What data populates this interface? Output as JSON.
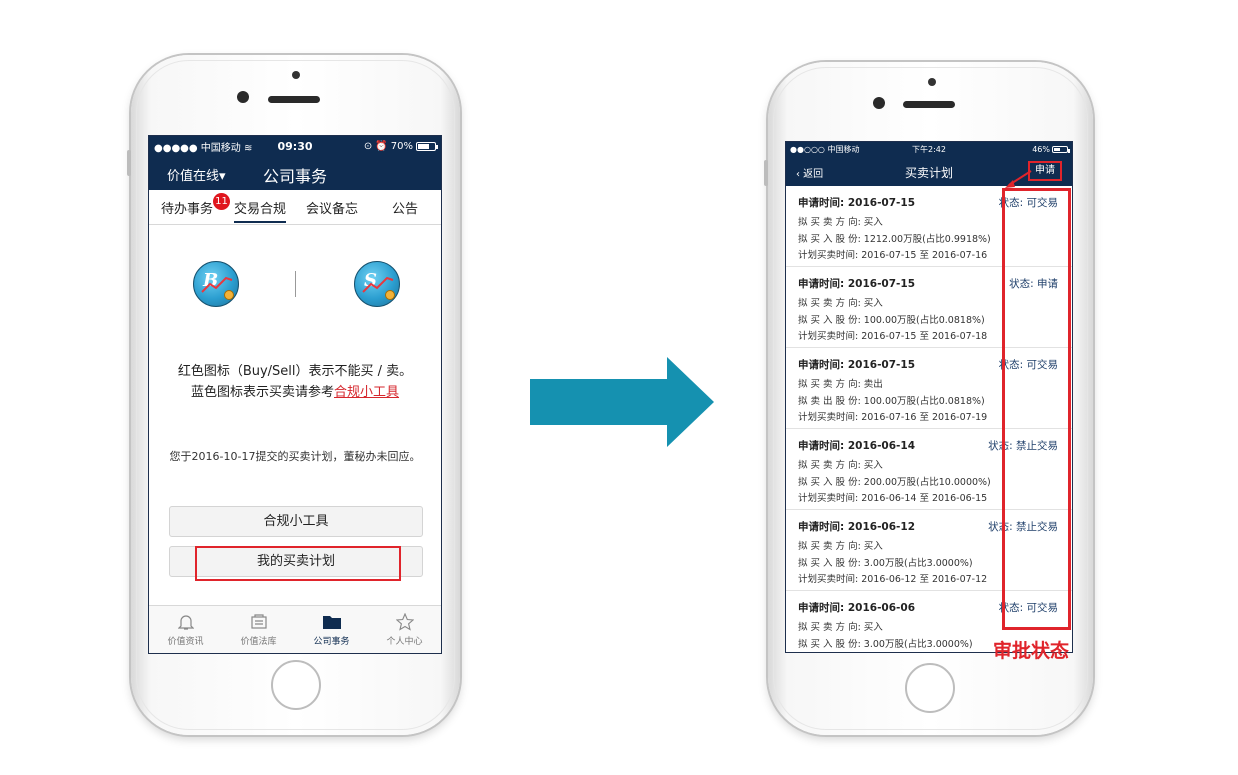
{
  "left": {
    "status_bar": {
      "carrier": "●●●●● 中国移动 ",
      "time": "09:30",
      "battery": "70%"
    },
    "nav": {
      "left_label": "价值在线▾",
      "title": "公司事务"
    },
    "tabs": [
      {
        "label": "待办事务",
        "badge": "11"
      },
      {
        "label": "交易合规"
      },
      {
        "label": "会议备忘"
      },
      {
        "label": "公告"
      }
    ],
    "info_line1": "红色图标（Buy/Sell）表示不能买 / 卖。",
    "info_line2_prefix": "蓝色图标表示买卖请参考",
    "info_line2_link": "合规小工具",
    "notice": "您于2016-10-17提交的买卖计划，董秘办未回应。",
    "buttons": {
      "tool": "合规小工具",
      "my_plan": "我的买卖计划"
    },
    "tabbar": [
      "价值资讯",
      "价值法库",
      "公司事务",
      "个人中心"
    ]
  },
  "right": {
    "status_bar": {
      "carrier": "●●○○○ 中国移动 ",
      "time": "下午2:42",
      "battery": "46%"
    },
    "nav": {
      "back": "‹ 返回",
      "title": "买卖计划",
      "apply": "申请"
    },
    "plans": [
      {
        "date": "申请时间: 2016-07-15",
        "status": "状态: 可交易",
        "direction": "拟 买 卖 方 向:  买入",
        "shares": "拟 买 入 股 份:  1212.00万股(占比0.9918%)",
        "period": "计划买卖时间:  2016-07-15 至 2016-07-16"
      },
      {
        "date": "申请时间: 2016-07-15",
        "status": "状态: 申请",
        "direction": "拟 买 卖 方 向:  买入",
        "shares": "拟 买 入 股 份:  100.00万股(占比0.0818%)",
        "period": "计划买卖时间:  2016-07-15 至 2016-07-18"
      },
      {
        "date": "申请时间: 2016-07-15",
        "status": "状态: 可交易",
        "direction": "拟 买 卖 方 向:  卖出",
        "shares": "拟 卖 出 股 份:  100.00万股(占比0.0818%)",
        "period": "计划买卖时间:  2016-07-16 至 2016-07-19"
      },
      {
        "date": "申请时间: 2016-06-14",
        "status": "状态: 禁止交易",
        "direction": "拟 买 卖 方 向:  买入",
        "shares": "拟 买 入 股 份:  200.00万股(占比10.0000%)",
        "period": "计划买卖时间:  2016-06-14 至 2016-06-15"
      },
      {
        "date": "申请时间: 2016-06-12",
        "status": "状态: 禁止交易",
        "direction": "拟 买 卖 方 向:  买入",
        "shares": "拟 买 入 股 份:  3.00万股(占比3.0000%)",
        "period": "计划买卖时间:  2016-06-12 至 2016-07-12"
      },
      {
        "date": "申请时间: 2016-06-06",
        "status": "状态: 可交易",
        "direction": "拟 买 卖 方 向:  买入",
        "shares": "拟 买 入 股 份:  3.00万股(占比3.0000%)",
        "period": ""
      }
    ]
  },
  "annotation": {
    "label": "审批状态"
  },
  "colors": {
    "navy": "#0f2c50",
    "highlight_red": "#e0242b",
    "arrow_teal": "#1591b0"
  }
}
